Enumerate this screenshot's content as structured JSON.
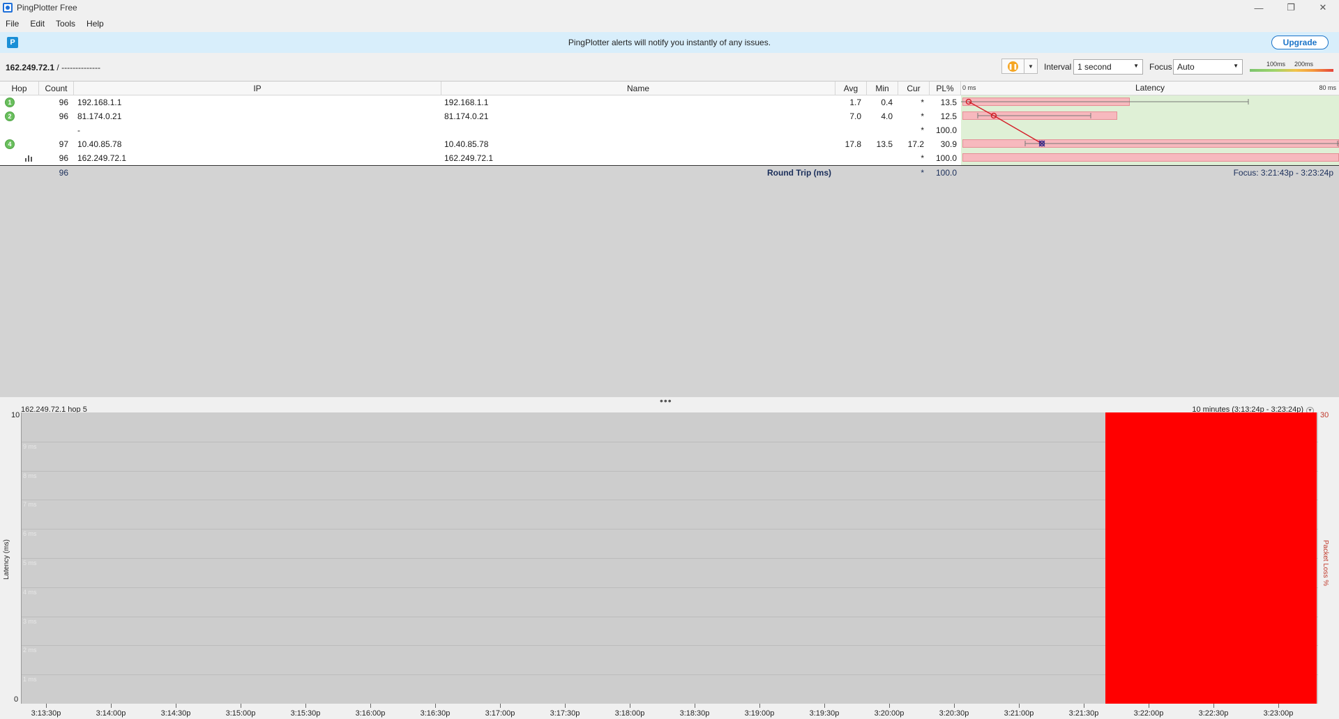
{
  "window": {
    "title": "PingPlotter Free",
    "minimize": "—",
    "maximize": "❐",
    "close": "✕"
  },
  "menu": [
    "File",
    "Edit",
    "Tools",
    "Help"
  ],
  "banner": {
    "text": "PingPlotter alerts will notify you instantly of any issues.",
    "upgrade": "Upgrade",
    "icon_letter": "P"
  },
  "toolbar": {
    "target": "162.249.72.1",
    "target_suffix": " /  --------------",
    "interval_label": "Interval",
    "interval_value": "1 second",
    "focus_label": "Focus",
    "focus_value": "Auto",
    "scale_100": "100ms",
    "scale_200": "200ms"
  },
  "table": {
    "headers": {
      "hop": "Hop",
      "count": "Count",
      "ip": "IP",
      "name": "Name",
      "avg": "Avg",
      "min": "Min",
      "cur": "Cur",
      "pl": "PL%",
      "latency": "Latency",
      "lat_min": "0 ms",
      "lat_max": "80 ms"
    },
    "rows": [
      {
        "hop": "1",
        "count": "96",
        "ip": "192.168.1.1",
        "name": "192.168.1.1",
        "avg": "1.7",
        "min": "0.4",
        "cur": "*",
        "pl": "13.5",
        "pl_value": 13.5
      },
      {
        "hop": "2",
        "count": "96",
        "ip": "81.174.0.21",
        "name": "81.174.0.21",
        "avg": "7.0",
        "min": "4.0",
        "cur": "*",
        "pl": "12.5",
        "pl_value": 12.5
      },
      {
        "hop": "",
        "count": "",
        "ip": "-",
        "name": "",
        "avg": "",
        "min": "",
        "cur": "*",
        "pl": "100.0",
        "pl_value": 100.0
      },
      {
        "hop": "4",
        "count": "97",
        "ip": "10.40.85.78",
        "name": "10.40.85.78",
        "avg": "17.8",
        "min": "13.5",
        "cur": "17.2",
        "pl": "30.9",
        "pl_value": 30.9
      },
      {
        "hop": "",
        "count": "96",
        "ip": "162.249.72.1",
        "name": "162.249.72.1",
        "avg": "",
        "min": "",
        "cur": "*",
        "pl": "100.0",
        "pl_value": 100.0
      }
    ],
    "summary": {
      "count": "96",
      "label": "Round Trip (ms)",
      "cur": "*",
      "pl": "100.0",
      "focus": "Focus: 3:21:43p - 3:23:24p"
    }
  },
  "graph": {
    "title": "162.249.72.1 hop 5",
    "range": "10 minutes (3:13:24p - 3:23:24p)",
    "y_axis_label": "Latency (ms)",
    "y_axis_right_label": "Packet Loss %",
    "y_top": "10",
    "y_bottom": "0",
    "y_right_top": "30",
    "grid_labels": [
      "9 ms",
      "8 ms",
      "7 ms",
      "6 ms",
      "5 ms",
      "4 ms",
      "3 ms",
      "2 ms",
      "1 ms"
    ],
    "x_ticks": [
      "3:13:30p",
      "3:14:00p",
      "3:14:30p",
      "3:15:00p",
      "3:15:30p",
      "3:16:00p",
      "3:16:30p",
      "3:17:00p",
      "3:17:30p",
      "3:18:00p",
      "3:18:30p",
      "3:19:00p",
      "3:19:30p",
      "3:20:00p",
      "3:20:30p",
      "3:21:00p",
      "3:21:30p",
      "3:22:00p",
      "3:22:30p",
      "3:23:00p"
    ],
    "loss_start_fraction": 0.8355,
    "loss_color": "#ff0000"
  },
  "colors": {
    "banner_bg": "#d8eefb",
    "upgrade_blue": "#1a73c8",
    "hop_green": "#6abf5e",
    "latency_bg": "#dff0d6",
    "pl_bar": "#f7b9be"
  }
}
